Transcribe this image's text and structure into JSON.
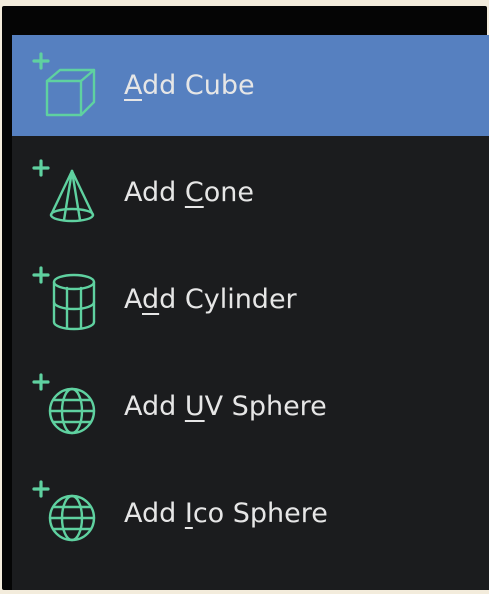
{
  "menu": {
    "items": [
      {
        "pre": "",
        "key": "A",
        "post": "dd Cube",
        "icon": "add-cube-icon",
        "active": true
      },
      {
        "pre": "Add ",
        "key": "C",
        "post": "one",
        "icon": "add-cone-icon",
        "active": false
      },
      {
        "pre": "A",
        "key": "d",
        "post": "d Cylinder",
        "icon": "add-cylinder-icon",
        "active": false
      },
      {
        "pre": "Add ",
        "key": "U",
        "post": "V Sphere",
        "icon": "add-uv-sphere-icon",
        "active": false
      },
      {
        "pre": "Add ",
        "key": "I",
        "post": "co Sphere",
        "icon": "add-ico-sphere-icon",
        "active": false
      }
    ]
  },
  "colors": {
    "panel_bg": "#1b1c1e",
    "active_bg": "#5680c0",
    "icon_green": "#5fd1a0",
    "text": "#e6e6e6"
  }
}
